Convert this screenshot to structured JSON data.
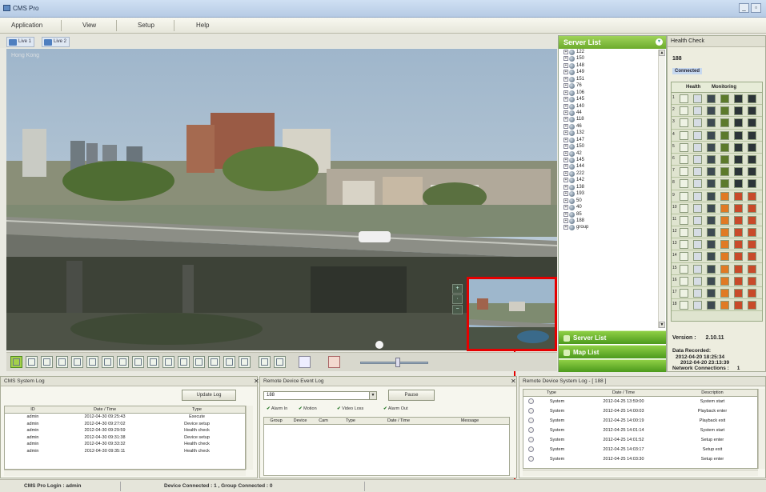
{
  "app": {
    "title": "CMS Pro"
  },
  "menu": [
    "Application",
    "View",
    "Setup",
    "Help"
  ],
  "tabs": [
    {
      "label": "Live 1"
    },
    {
      "label": "Live 2"
    }
  ],
  "video": {
    "overlay_label": "Hong Kong"
  },
  "ptz": {
    "up": "+",
    "mid": "·",
    "down": "−"
  },
  "server_list": {
    "header": "Server List",
    "nodes": [
      "122",
      "150",
      "148",
      "149",
      "151",
      "76",
      "106",
      "145",
      "140",
      "44",
      "118",
      "46",
      "132",
      "147",
      "150",
      "42",
      "145",
      "144",
      "222",
      "142",
      "138",
      "193",
      "50",
      "40",
      "85",
      "188",
      "group"
    ],
    "buttons": {
      "server": "Server List",
      "map": "Map List"
    }
  },
  "health": {
    "header": "Health Check",
    "device_id": "188",
    "connected_label": "Connected",
    "col_health": "Health",
    "col_monitoring": "Monitoring",
    "row_numbers": [
      "1",
      "2",
      "3",
      "4",
      "5",
      "6",
      "7",
      "8",
      "9",
      "10",
      "11",
      "12",
      "13",
      "14",
      "15",
      "16",
      "17",
      "18"
    ],
    "version_label": "Version :",
    "version": "2.10.11",
    "data_recorded_label": "Data Recorded:",
    "data_recorded_from": "2012-04-20 18:25:34",
    "data_recorded_to": "2012-04-20 23:13:39",
    "network_label": "Network Connections :",
    "network_value": "1"
  },
  "system_log": {
    "header": "CMS System Log",
    "update_button": "Update Log",
    "columns": [
      "ID",
      "Date / Time",
      "Type"
    ],
    "rows": [
      {
        "id": "admin",
        "time": "2012-04-30 09:25:43",
        "type": "Execute"
      },
      {
        "id": "admin",
        "time": "2012-04-30 09:27:02",
        "type": "Device setup"
      },
      {
        "id": "admin",
        "time": "2012-04-30 09:29:59",
        "type": "Health check"
      },
      {
        "id": "admin",
        "time": "2012-04-30 09:31:38",
        "type": "Device setup"
      },
      {
        "id": "admin",
        "time": "2012-04-30 09:33:32",
        "type": "Health check"
      },
      {
        "id": "admin",
        "time": "2012-04-30 09:35:11",
        "type": "Health check"
      }
    ]
  },
  "event_log": {
    "header": "Remote Device Event Log",
    "select_value": "188",
    "pause_button": "Pause",
    "filters": [
      "Alarm In",
      "Motion",
      "Video Loss",
      "Alarm Out"
    ],
    "columns": [
      "Group",
      "Device",
      "Cam",
      "Type",
      "Date / Time",
      "Message"
    ]
  },
  "device_syslog": {
    "header": "Remote Device System Log - [ 188 ]",
    "columns": [
      "Type",
      "Date / Time",
      "Description"
    ],
    "rows": [
      {
        "type": "System",
        "time": "2012-04-25 13:59:00",
        "desc": "System start"
      },
      {
        "type": "System",
        "time": "2012-04-25 14:00:03",
        "desc": "Playback enter"
      },
      {
        "type": "System",
        "time": "2012-04-25 14:00:19",
        "desc": "Playback exit"
      },
      {
        "type": "System",
        "time": "2012-04-25 14:01:14",
        "desc": "System start"
      },
      {
        "type": "System",
        "time": "2012-04-25 14:01:52",
        "desc": "Setup enter"
      },
      {
        "type": "System",
        "time": "2012-04-25 14:03:17",
        "desc": "Setup exit"
      },
      {
        "type": "System",
        "time": "2012-04-25 14:03:30",
        "desc": "Setup enter"
      }
    ]
  },
  "status": {
    "login": "CMS Pro Login : admin",
    "connection": "Device Connected : 1 , Group Connected : 0"
  },
  "colors": {
    "accent_green": "#6cab2c",
    "highlight_red": "#e50000"
  }
}
